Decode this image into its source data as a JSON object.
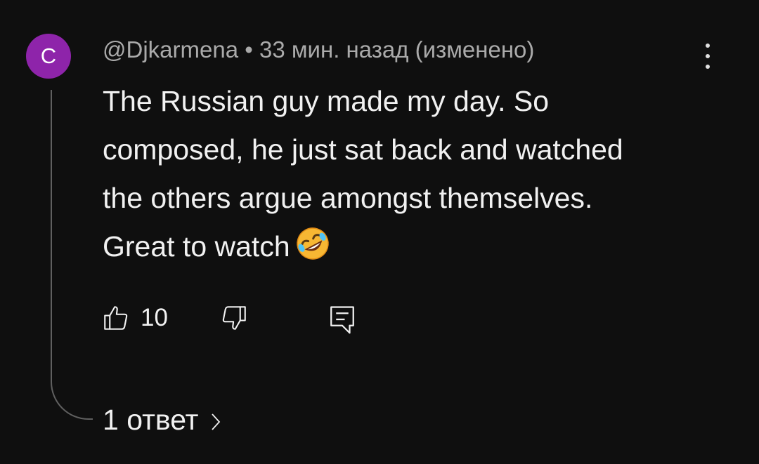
{
  "comment": {
    "avatar_letter": "C",
    "avatar_color": "#8e24aa",
    "author": "@Djkarmena",
    "separator": "•",
    "time": "33 мин. назад",
    "edited": "(изменено)",
    "text": "The Russian guy made my day. So composed, he just sat back and watched the others argue amongst themselves. Great to watch",
    "emoji": "rolling-on-the-floor-laughing-emoji",
    "like_count": "10",
    "replies_label": "1 ответ"
  },
  "icons": {
    "more": "more-vertical-icon",
    "like": "thumbs-up-icon",
    "dislike": "thumbs-down-icon",
    "reply": "reply-comment-icon",
    "expand": "chevron-right-icon"
  },
  "colors": {
    "background": "#0f0f0f",
    "text": "#f1f1f1",
    "secondary_text": "#aaaaaa",
    "thread_line": "#606060"
  }
}
